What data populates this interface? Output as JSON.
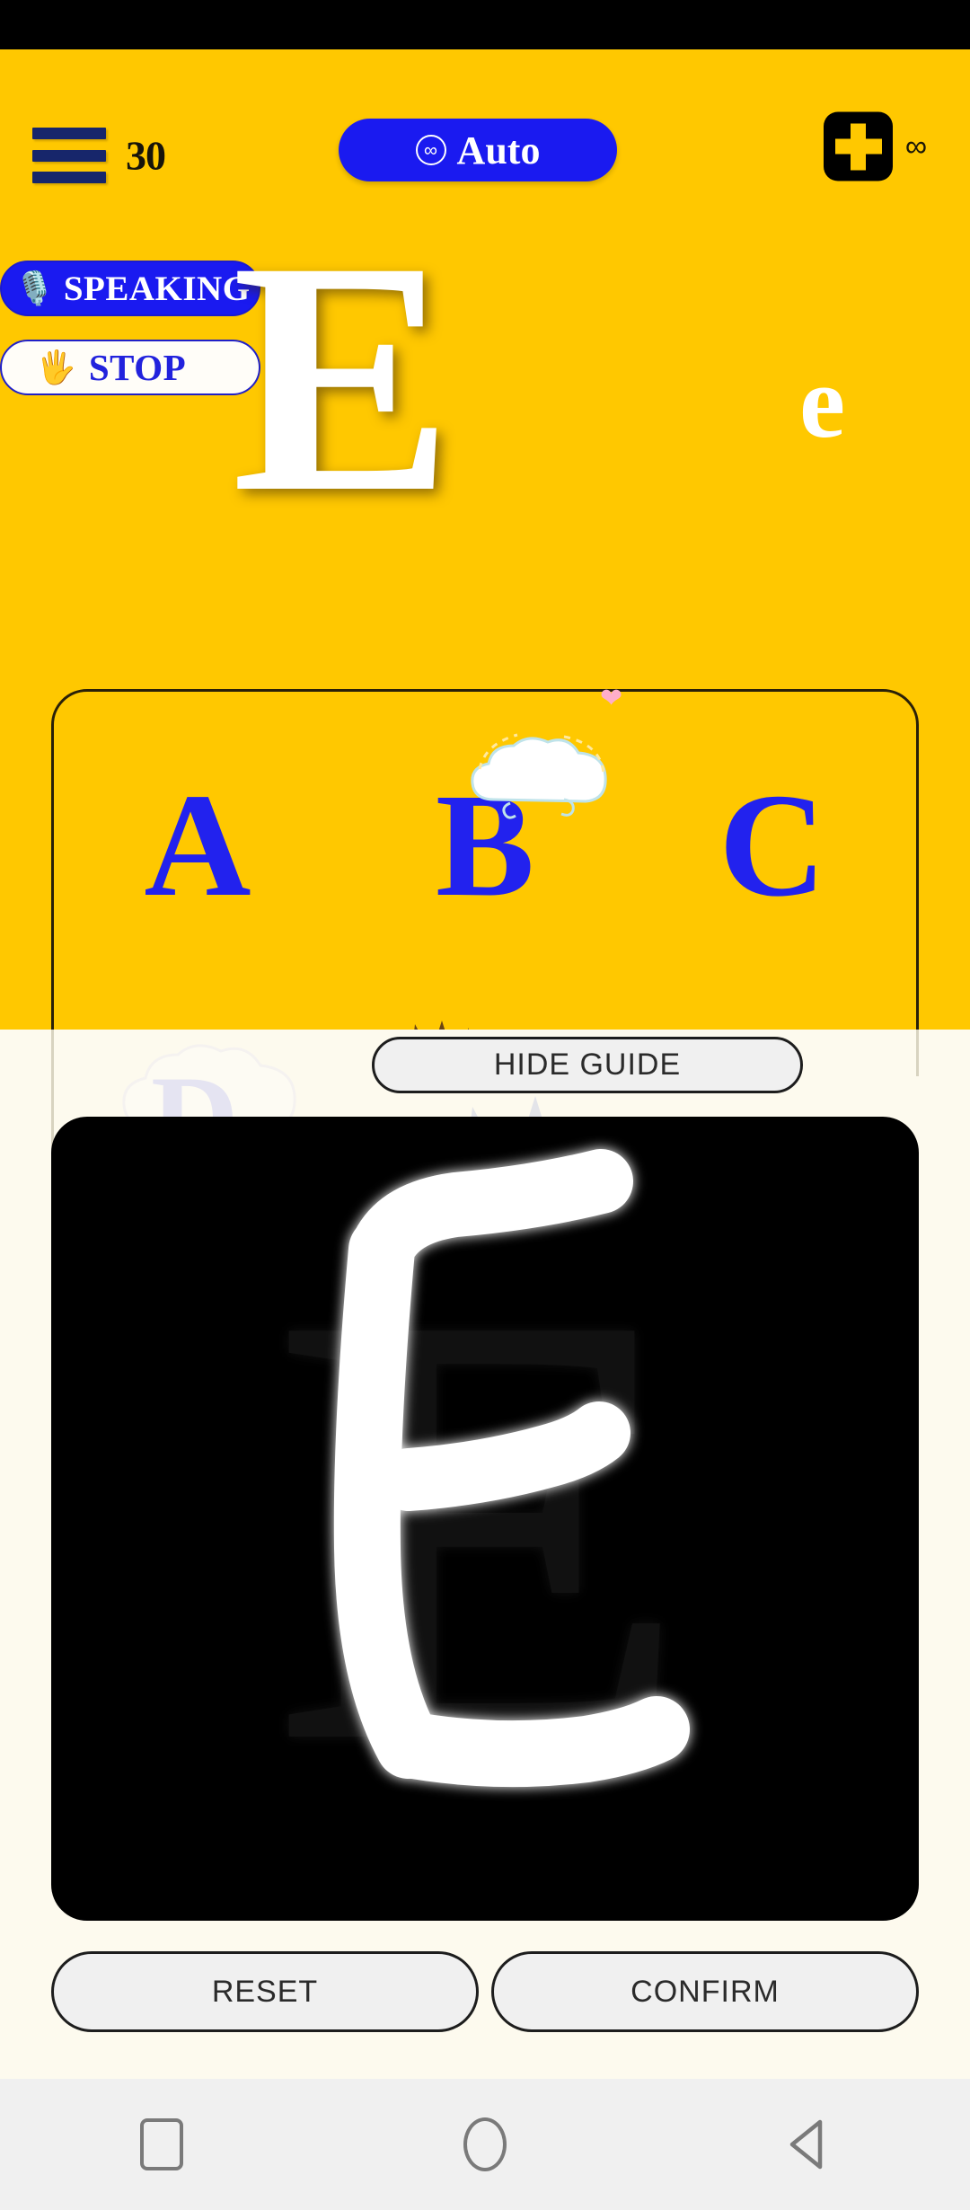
{
  "app": {
    "accent_blue": "#1A1AF0",
    "background_yellow": "#FFC800",
    "background_cream": "#FDFAEE",
    "canvas_black": "#000000"
  },
  "top_bar": {
    "menu_icon": "hamburger-icon",
    "menu_count": "30",
    "auto_button": {
      "icon": "infinity-circle-icon",
      "icon_glyph": "∞",
      "label": "Auto"
    },
    "plus_button": {
      "icon": "plus-icon",
      "label": "+"
    },
    "infinity_badge": "∞"
  },
  "voice_controls": {
    "speaking": {
      "icon": "microphone-icon",
      "icon_glyph": "🎙️",
      "label": "SPEAKING"
    },
    "stop": {
      "icon": "raised-hand-icon",
      "icon_glyph": "🖐️",
      "label": "STOP"
    }
  },
  "letter_display": {
    "uppercase": "E",
    "lowercase": "e"
  },
  "alphabet_card": {
    "letters": [
      "A",
      "B",
      "C"
    ],
    "decorations": [
      "cloud-icon",
      "heart-icon",
      "eagle-icon"
    ]
  },
  "guide": {
    "toggle_label": "HIDE GUIDE"
  },
  "canvas": {
    "guide_letter": "E",
    "traced_letter": "E"
  },
  "actions": {
    "reset_label": "RESET",
    "confirm_label": "CONFIRM"
  },
  "nav_bar": {
    "recents": "recents-square-icon",
    "home": "home-circle-icon",
    "back": "back-triangle-icon"
  }
}
